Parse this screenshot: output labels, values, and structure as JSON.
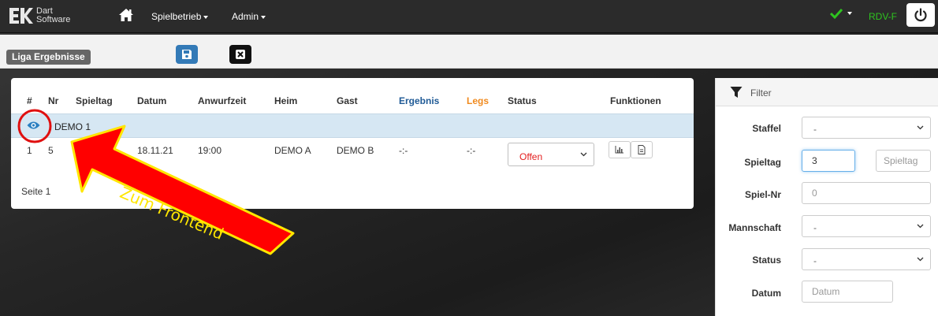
{
  "app": {
    "logo_line1": "Dart",
    "logo_line2": "Software"
  },
  "nav": {
    "menu1": "Spielbetrieb",
    "menu2": "Admin",
    "user": "RDV-F"
  },
  "toolbar": {
    "page_label": "Liga Ergebnisse"
  },
  "table": {
    "headers": [
      "#",
      "Nr",
      "Spieltag",
      "Datum",
      "Anwurfzeit",
      "Heim",
      "Gast",
      "Ergebnis",
      "Legs",
      "Status",
      "Funktionen"
    ],
    "group": "DEMO 1",
    "row": {
      "index": "1",
      "nr": "5",
      "datum": "18.11.21",
      "anwurfzeit": "19:00",
      "heim": "DEMO A",
      "gast": "DEMO B",
      "ergebnis": "-:-",
      "legs": "-:-",
      "status": "Offen"
    },
    "page_info": "Seite 1"
  },
  "filter": {
    "title": "Filter",
    "staffel_label": "Staffel",
    "staffel_value": "-",
    "spieltag_label": "Spieltag",
    "spieltag_value": "3",
    "spieltag_placeholder": "Spieltag",
    "spielnr_label": "Spiel-Nr",
    "spielnr_placeholder": "0",
    "mannschaft_label": "Mannschaft",
    "mannschaft_value": "-",
    "status_label": "Status",
    "status_value": "-",
    "datum_label": "Datum",
    "datum_placeholder": "Datum"
  },
  "annotation": {
    "text": "Zum Frontend"
  },
  "colors": {
    "accent_blue": "#337ab7",
    "status_red": "#e31e1e",
    "user_green": "#2ec41f",
    "ergebnis_blue": "#1f5a96",
    "legs_orange": "#f08a1e",
    "annotation_red": "#ff0000",
    "annotation_yellow": "#ffe600"
  }
}
